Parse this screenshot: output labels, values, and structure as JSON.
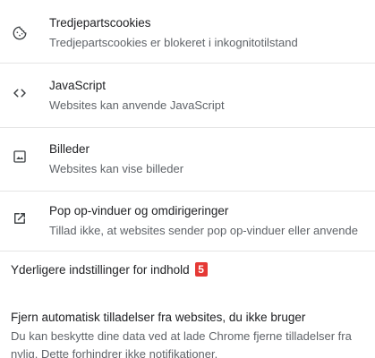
{
  "settings": [
    {
      "title": "Tredjepartscookies",
      "description": "Tredjepartscookies er blokeret i inkognitotilstand",
      "icon": "cookie-icon"
    },
    {
      "title": "JavaScript",
      "description": "Websites kan anvende JavaScript",
      "icon": "code-icon"
    },
    {
      "title": "Billeder",
      "description": "Websites kan vise billeder",
      "icon": "image-icon"
    },
    {
      "title": "Pop op-vinduer og omdirigeringer",
      "description": "Tillad ikke, at websites sender pop op-vinduer eller anvende",
      "icon": "open-in-new-icon"
    }
  ],
  "additional": {
    "label": "Yderligere indstillinger for indhold",
    "badge": "5",
    "badge_color": "#e53935"
  },
  "auto_remove": {
    "title": "Fjern automatisk tilladelser fra websites, du ikke bruger",
    "description_line1": "Du kan beskytte dine data ved at lade Chrome fjerne tilladelser fra",
    "description_line2": "nylig. Dette forhindrer ikke notifikationer."
  },
  "colors": {
    "primary_text": "#202124",
    "secondary_text": "#5f6368",
    "divider": "#e5e5e5"
  }
}
